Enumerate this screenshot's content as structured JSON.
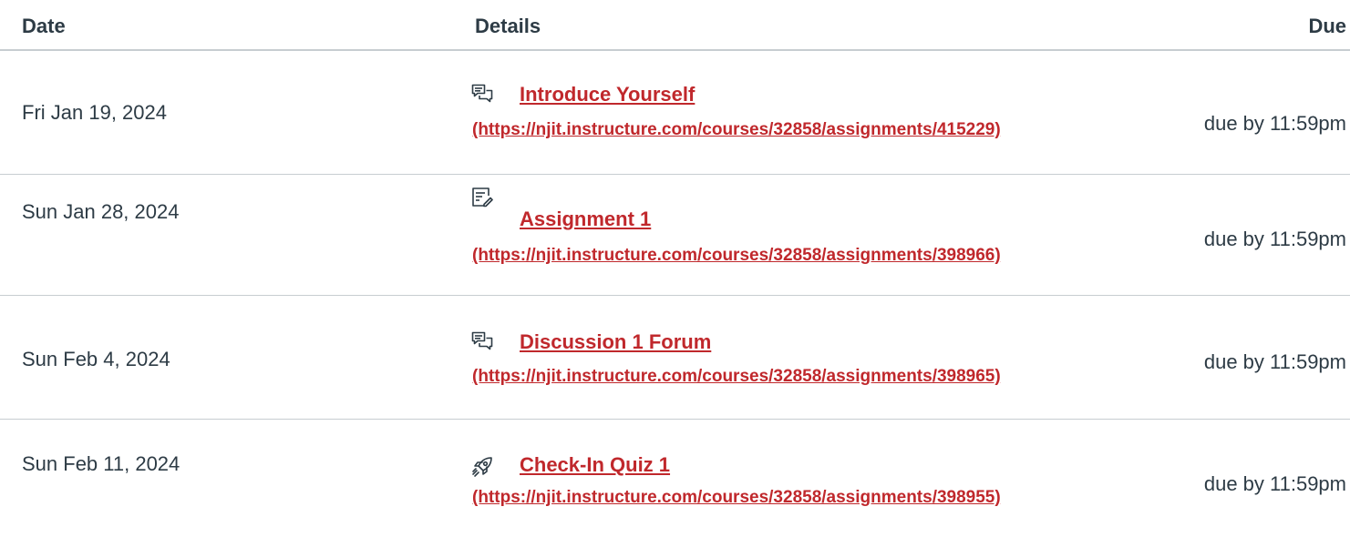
{
  "table": {
    "headers": {
      "date": "Date",
      "details": "Details",
      "due": "Due"
    },
    "rows": [
      {
        "date": "Fri Jan 19, 2024",
        "icon": "discussion-icon",
        "title": "Introduce Yourself",
        "url": "(https://njit.instructure.com/courses/32858/assignments/415229)",
        "due": "due by 11:59pm"
      },
      {
        "date": "Sun Jan 28, 2024",
        "icon": "assignment-icon",
        "title": "Assignment 1",
        "url": "(https://njit.instructure.com/courses/32858/assignments/398966)",
        "due": "due by 11:59pm"
      },
      {
        "date": "Sun Feb 4, 2024",
        "icon": "discussion-icon",
        "title": "Discussion 1 Forum",
        "url": "(https://njit.instructure.com/courses/32858/assignments/398965)",
        "due": "due by 11:59pm"
      },
      {
        "date": "Sun Feb 11, 2024",
        "icon": "quiz-rocket-icon",
        "title": "Check-In Quiz 1",
        "url": "(https://njit.instructure.com/courses/32858/assignments/398955)",
        "due": "due by 11:59pm"
      }
    ]
  },
  "colors": {
    "link": "#c0282c",
    "text": "#2d3b45",
    "divider": "#c7cdd1"
  }
}
